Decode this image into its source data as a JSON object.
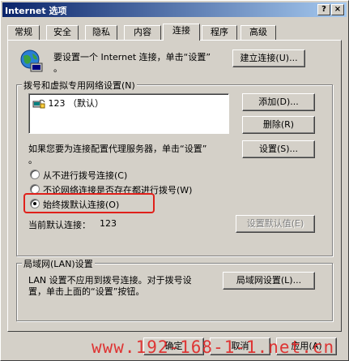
{
  "window": {
    "title": "Internet 选项",
    "help_label": "?",
    "close_label": "×"
  },
  "tabs": [
    {
      "label": "常规"
    },
    {
      "label": "安全"
    },
    {
      "label": "隐私"
    },
    {
      "label": "内容"
    },
    {
      "label": "连接",
      "active": true
    },
    {
      "label": "程序"
    },
    {
      "label": "高级"
    }
  ],
  "setup": {
    "text": "要设置一个 Internet 连接，单击“设置”",
    "text2": "。",
    "button": "建立连接(U)..."
  },
  "dialup": {
    "group_label": "拨号和虚拟专用网络设置(N)",
    "items": [
      {
        "label": "123 （默认）"
      }
    ],
    "add_button": "添加(D)...",
    "remove_button": "删除(R)",
    "proxy_text": "如果您要为连接配置代理服务器，单击“设置”",
    "proxy_text2": "。",
    "settings_button": "设置(S)...",
    "options": [
      {
        "label": "从不进行拨号连接(C)",
        "selected": false
      },
      {
        "label": "不论网络连接是否存在都进行拨号(W)",
        "selected": false
      },
      {
        "label": "始终拨默认连接(O)",
        "selected": true
      }
    ],
    "current_default_label": "当前默认连接：",
    "current_default_value": "123",
    "set_default_button": "设置默认值(E)"
  },
  "lan": {
    "group_label": "局域网(LAN)设置",
    "text1": "LAN 设置不应用到拨号连接。对于拨号设",
    "text2": "置，单击上面的“设置”按钮。",
    "button": "局域网设置(L)..."
  },
  "footer": {
    "ok_button": "确定",
    "cancel_button": "取消",
    "apply_button": "应用(A)"
  },
  "watermark": "www.192-168-1-1.net.cn",
  "colors": {
    "titlebar_start": "#0a246a",
    "highlight": "#e0201a",
    "watermark": "#e02020"
  }
}
